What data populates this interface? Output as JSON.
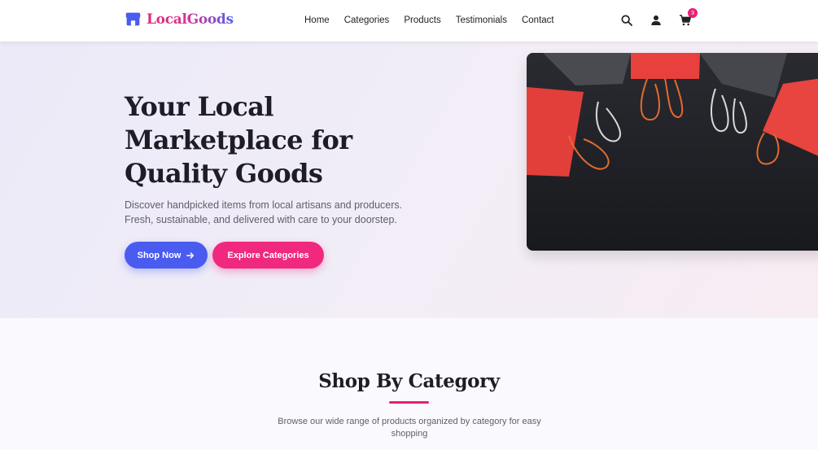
{
  "header": {
    "brand": "LocalGoods",
    "nav": [
      {
        "label": "Home"
      },
      {
        "label": "Categories"
      },
      {
        "label": "Products"
      },
      {
        "label": "Testimonials"
      },
      {
        "label": "Contact"
      }
    ],
    "icons": [
      "search-icon",
      "user-icon",
      "cart-icon"
    ],
    "cart_count": "3"
  },
  "hero": {
    "title": "Your Local Marketplace for Quality Goods",
    "description": "Discover handpicked items from local artisans and producers. Fresh, sustainable, and delivered with care to your doorstep.",
    "primary_button": "Shop Now",
    "secondary_button": "Explore Categories",
    "image": "shopping-bags-photo"
  },
  "categories_section": {
    "title": "Shop By Category",
    "description": "Browse our wide range of products organized by category for easy shopping"
  },
  "colors": {
    "brand_blue": "#4a5bf0",
    "brand_pink": "#e91e78",
    "heading": "#1d1d26"
  }
}
